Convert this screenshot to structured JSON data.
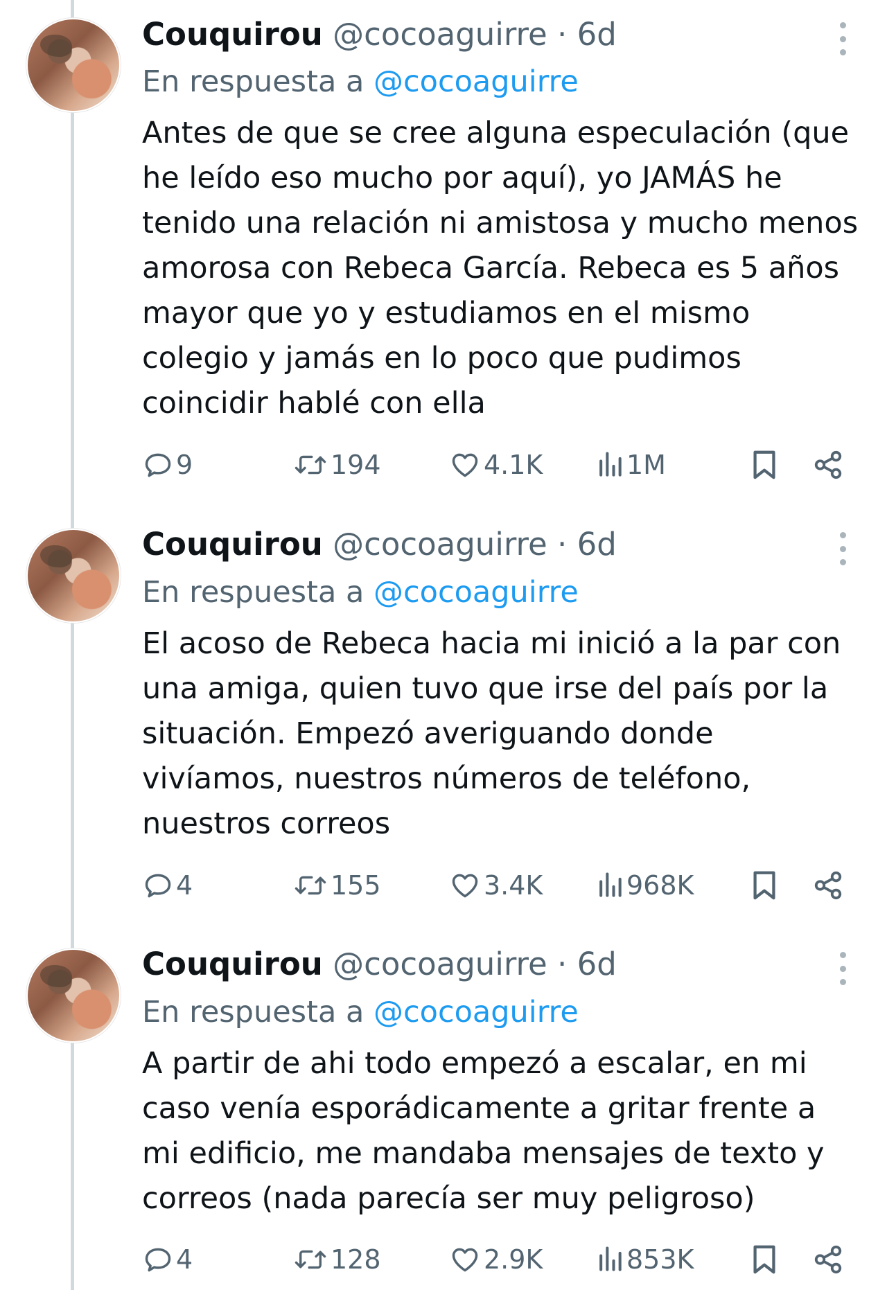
{
  "tweets": [
    {
      "name": "Couquirou",
      "handle": "@cocoaguirre",
      "dot": "·",
      "time": "6d",
      "reply_prefix": "En respuesta a",
      "reply_mention": "@cocoaguirre",
      "text": "Antes de que se cree alguna especulación (que he leído eso mucho por aquí), yo JAMÁS he tenido una relación ni amistosa y mucho menos amorosa con Rebeca García. Rebeca es 5 años mayor que yo y estudiamos en el mismo colegio y jamás en lo poco que pudimos coincidir hablé con ella",
      "replies": "9",
      "retweets": "194",
      "likes": "4.1K",
      "views": "1M"
    },
    {
      "name": "Couquirou",
      "handle": "@cocoaguirre",
      "dot": "·",
      "time": "6d",
      "reply_prefix": "En respuesta a",
      "reply_mention": "@cocoaguirre",
      "text": "El acoso de Rebeca hacia mi inició a la par con una amiga, quien tuvo que irse del país por la situación. Empezó averiguando donde vivíamos, nuestros números de teléfono, nuestros correos",
      "replies": "4",
      "retweets": "155",
      "likes": "3.4K",
      "views": "968K"
    },
    {
      "name": "Couquirou",
      "handle": "@cocoaguirre",
      "dot": "·",
      "time": "6d",
      "reply_prefix": "En respuesta a",
      "reply_mention": "@cocoaguirre",
      "text": "A partir de ahi todo empezó a escalar, en mi caso venía esporádicamente a gritar frente a mi edificio, me mandaba mensajes de texto y correos (nada parecía ser muy peligroso)",
      "replies": "4",
      "retweets": "128",
      "likes": "2.9K",
      "views": "853K"
    }
  ],
  "icons": {
    "reply": "reply-icon",
    "retweet": "retweet-icon",
    "like": "heart-icon",
    "views": "views-chart-icon",
    "bookmark": "bookmark-icon",
    "share": "share-icon",
    "more": "more-vertical-icon"
  },
  "colors": {
    "text": "#0f1419",
    "secondary": "#536471",
    "link": "#1d9bf0",
    "thread_line": "#cfd9de"
  }
}
